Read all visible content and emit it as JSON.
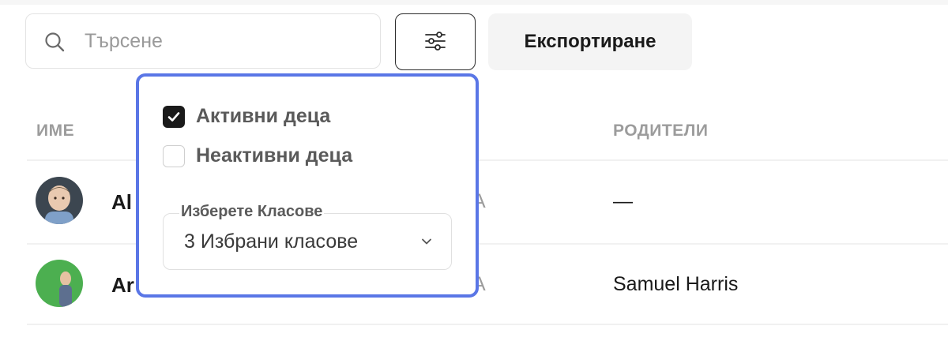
{
  "search": {
    "placeholder": "Търсене"
  },
  "toolbar": {
    "export_label": "Експортиране"
  },
  "table": {
    "headers": {
      "name": "ИМЕ",
      "parents": "РОДИТЕЛИ"
    },
    "rows": [
      {
        "name": "Al",
        "class_partial": "A",
        "parents": "—"
      },
      {
        "name": "Ar",
        "class_partial": "A",
        "parents": "Samuel Harris"
      }
    ]
  },
  "filter_popover": {
    "checkboxes": [
      {
        "label": "Активни деца",
        "checked": true
      },
      {
        "label": "Неактивни деца",
        "checked": false
      }
    ],
    "class_select": {
      "legend": "Изберете Класове",
      "value": "3 Избрани класове"
    }
  },
  "colors": {
    "accent_border": "#5a76e6",
    "checkbox_checked": "#1a1a1a",
    "avatar_green": "#4caf50"
  }
}
